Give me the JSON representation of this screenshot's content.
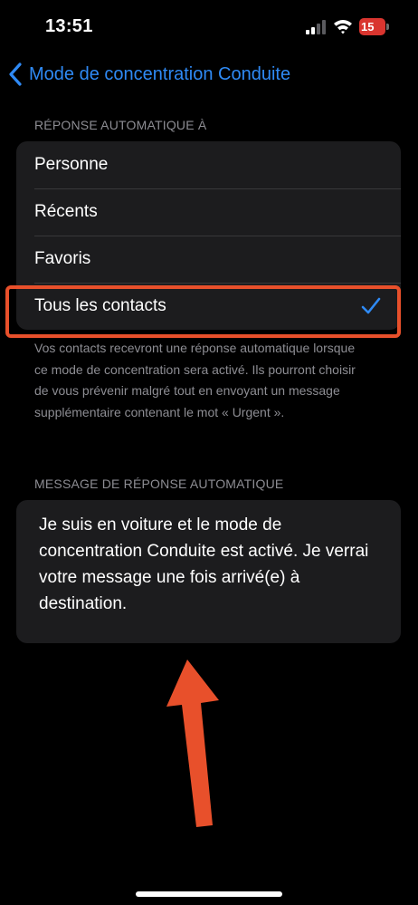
{
  "status_bar": {
    "time": "13:51",
    "battery_level": "15",
    "battery_color": "#d9352f",
    "icons": [
      "signal-icon",
      "wifi-icon",
      "battery-icon"
    ]
  },
  "nav": {
    "back_label": "Mode de concentration Conduite",
    "accent_color": "#2f8af5"
  },
  "auto_reply": {
    "header": "RÉPONSE AUTOMATIQUE À",
    "options": [
      {
        "label": "Personne",
        "selected": false
      },
      {
        "label": "Récents",
        "selected": false
      },
      {
        "label": "Favoris",
        "selected": false
      },
      {
        "label": "Tous les contacts",
        "selected": true
      }
    ],
    "footer": "Vos contacts recevront une réponse automatique lorsque ce mode de concentration sera activé. Ils pourront choisir de vous prévenir malgré tout en envoyant un message supplémentaire contenant le mot « Urgent »."
  },
  "message": {
    "header": "MESSAGE DE RÉPONSE AUTOMATIQUE",
    "text": "Je suis en voiture et le mode de concentration Conduite est activé. Je verrai votre message une fois arrivé(e) à destination."
  },
  "annotation_color": "#e8502b"
}
